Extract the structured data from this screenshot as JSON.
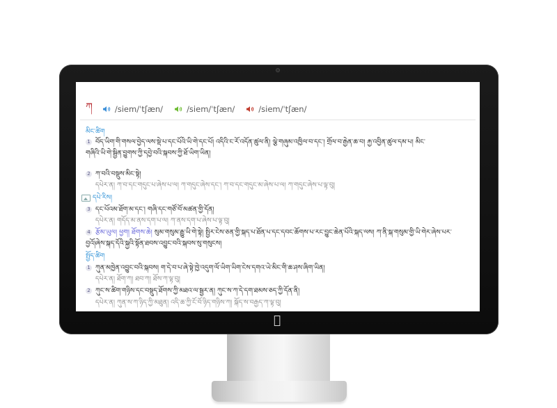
{
  "entry": {
    "headword": "ཀ",
    "pronunciations": [
      {
        "ipa": "/siem/ˈtʃæn/",
        "speaker_color": "#3b8fd9"
      },
      {
        "ipa": "/siem/ˈtʃæn/",
        "speaker_color": "#6aba2e"
      },
      {
        "ipa": "/siem/ˈtʃæn/",
        "speaker_color": "#c0392b"
      }
    ]
  },
  "sections": {
    "definition_title": "མིང་ཚིག",
    "def1": "བོད་ཡིག་གི་གསལ་བྱེད་ལས་སྡེ་པ་དང་པོའི་ཡི་གེ་དང་པོ། འདིའི་ང་རོ་འདོན་ཚུལ་ནི། ལྕེ་གཞུམ་འཁྱིལ་བ་དང་། གྲོལ་བ་རྒྱེན་ཆ་བ། རྐྱ་འབྱིན་ཚུལ་དམ་པ། མིང་",
    "def1_cont": "གཞིའི་ཡི་གེ་སྦྱིན་བྱུགས་ཀྱི་དབྱེ་བའི་སྐབས་ཀྱི་ཐོ་ཡིག་ཡིན།",
    "def2": "ཀ་བའི་བསྡུས་མིང་སྟེ།",
    "def2_ex": "དཔེར་ན། ཀ་བ་དང་གདུང་པ་ཞེས་པ་ལ། ཀ་གདུང་ཞེས་དང་། ཀ་བ་དང་གདུང་མ་ཞེས་པ་ལ། ཀ་གདུང་ཞེས་པ་ལྟ་བུ།",
    "examples_title": "དཔེ་རིས།",
    "def3": "དང་པོའམ་ཐོག་མ་དང་། གཞི་དང་གཙོ་བོ་མཚན་གྱི་དོན།",
    "def3_ex": "དཔེར་ན། གདོད་མ་ནས་དག་པ་ལ། ཀ་ནས་དག་པ་ཞེས་པ་ལྟ་བུ།",
    "def4_tags": "རྩོམ་ཡུལ། ཕྱག། ཐོགས་ཆེ།",
    "def4": "སུམ་གསུམ་རྒྱུ་ཡི་གེ་སྟེ། སྤྱིར་ངེས་ཅན་གྱི་སྐད་པ་ཐོན་པ་དང་དབང་ཆོགས་པ་རང་བྱུང་ཆེན་པོའི་སྐད་ལས། ཀ་ནི་སྐ་གསུམ་གྱི་ཡི་གེར་ཞེས་པར་",
    "def4_cont": "བྱའོ།ཞེས་སྐད་དོའི་སྐྱའི་སྟོན་ཐབས་འབྱུང་བའི་སྐབས་སུ་གསུངས།",
    "synonyms_title": "སྤྱོད་ཚིག",
    "syn1": "ཀུན་མཁྱེན་འབྱུང་བའི་སྐབས། ག་དེ་བ་པ་ཞེ་སྟེ་ཁྱེ་འདུག་ལོ་ཡིག་ཡིག་ངེས་དགའ་ཡེ་མིང་གི་ཆ་ཤས་ཞིག་ཡིན།",
    "syn1_ex": "དཔེར་ན། ཐོག་ཀ། ཐབ་ཀ། ཐོས་ཀ་ལྟ་བུ།",
    "syn2": "ཀུང་ས་ཚིག་གཉིས་དང་བསྡུད་ཐོགས་ཀྱི་མཐའ་ལ་སྦྱར་ན། ཀུང་ས་ཀ་དེ་དག་ཐམས་ཅད་ཀྱི་དོན་ནི།",
    "syn2_ex": "དཔེར་ན། ཀུན་ས་ཀ་ཉིད་ཀྱི་མཐུན། འདི་ཆ་ཀྱི་ངོ་བོ་ཉིད་གཉིས་ཀ། སྐོད་ས་བརྒྱད་ཀ་ལྟ་བུ།"
  }
}
